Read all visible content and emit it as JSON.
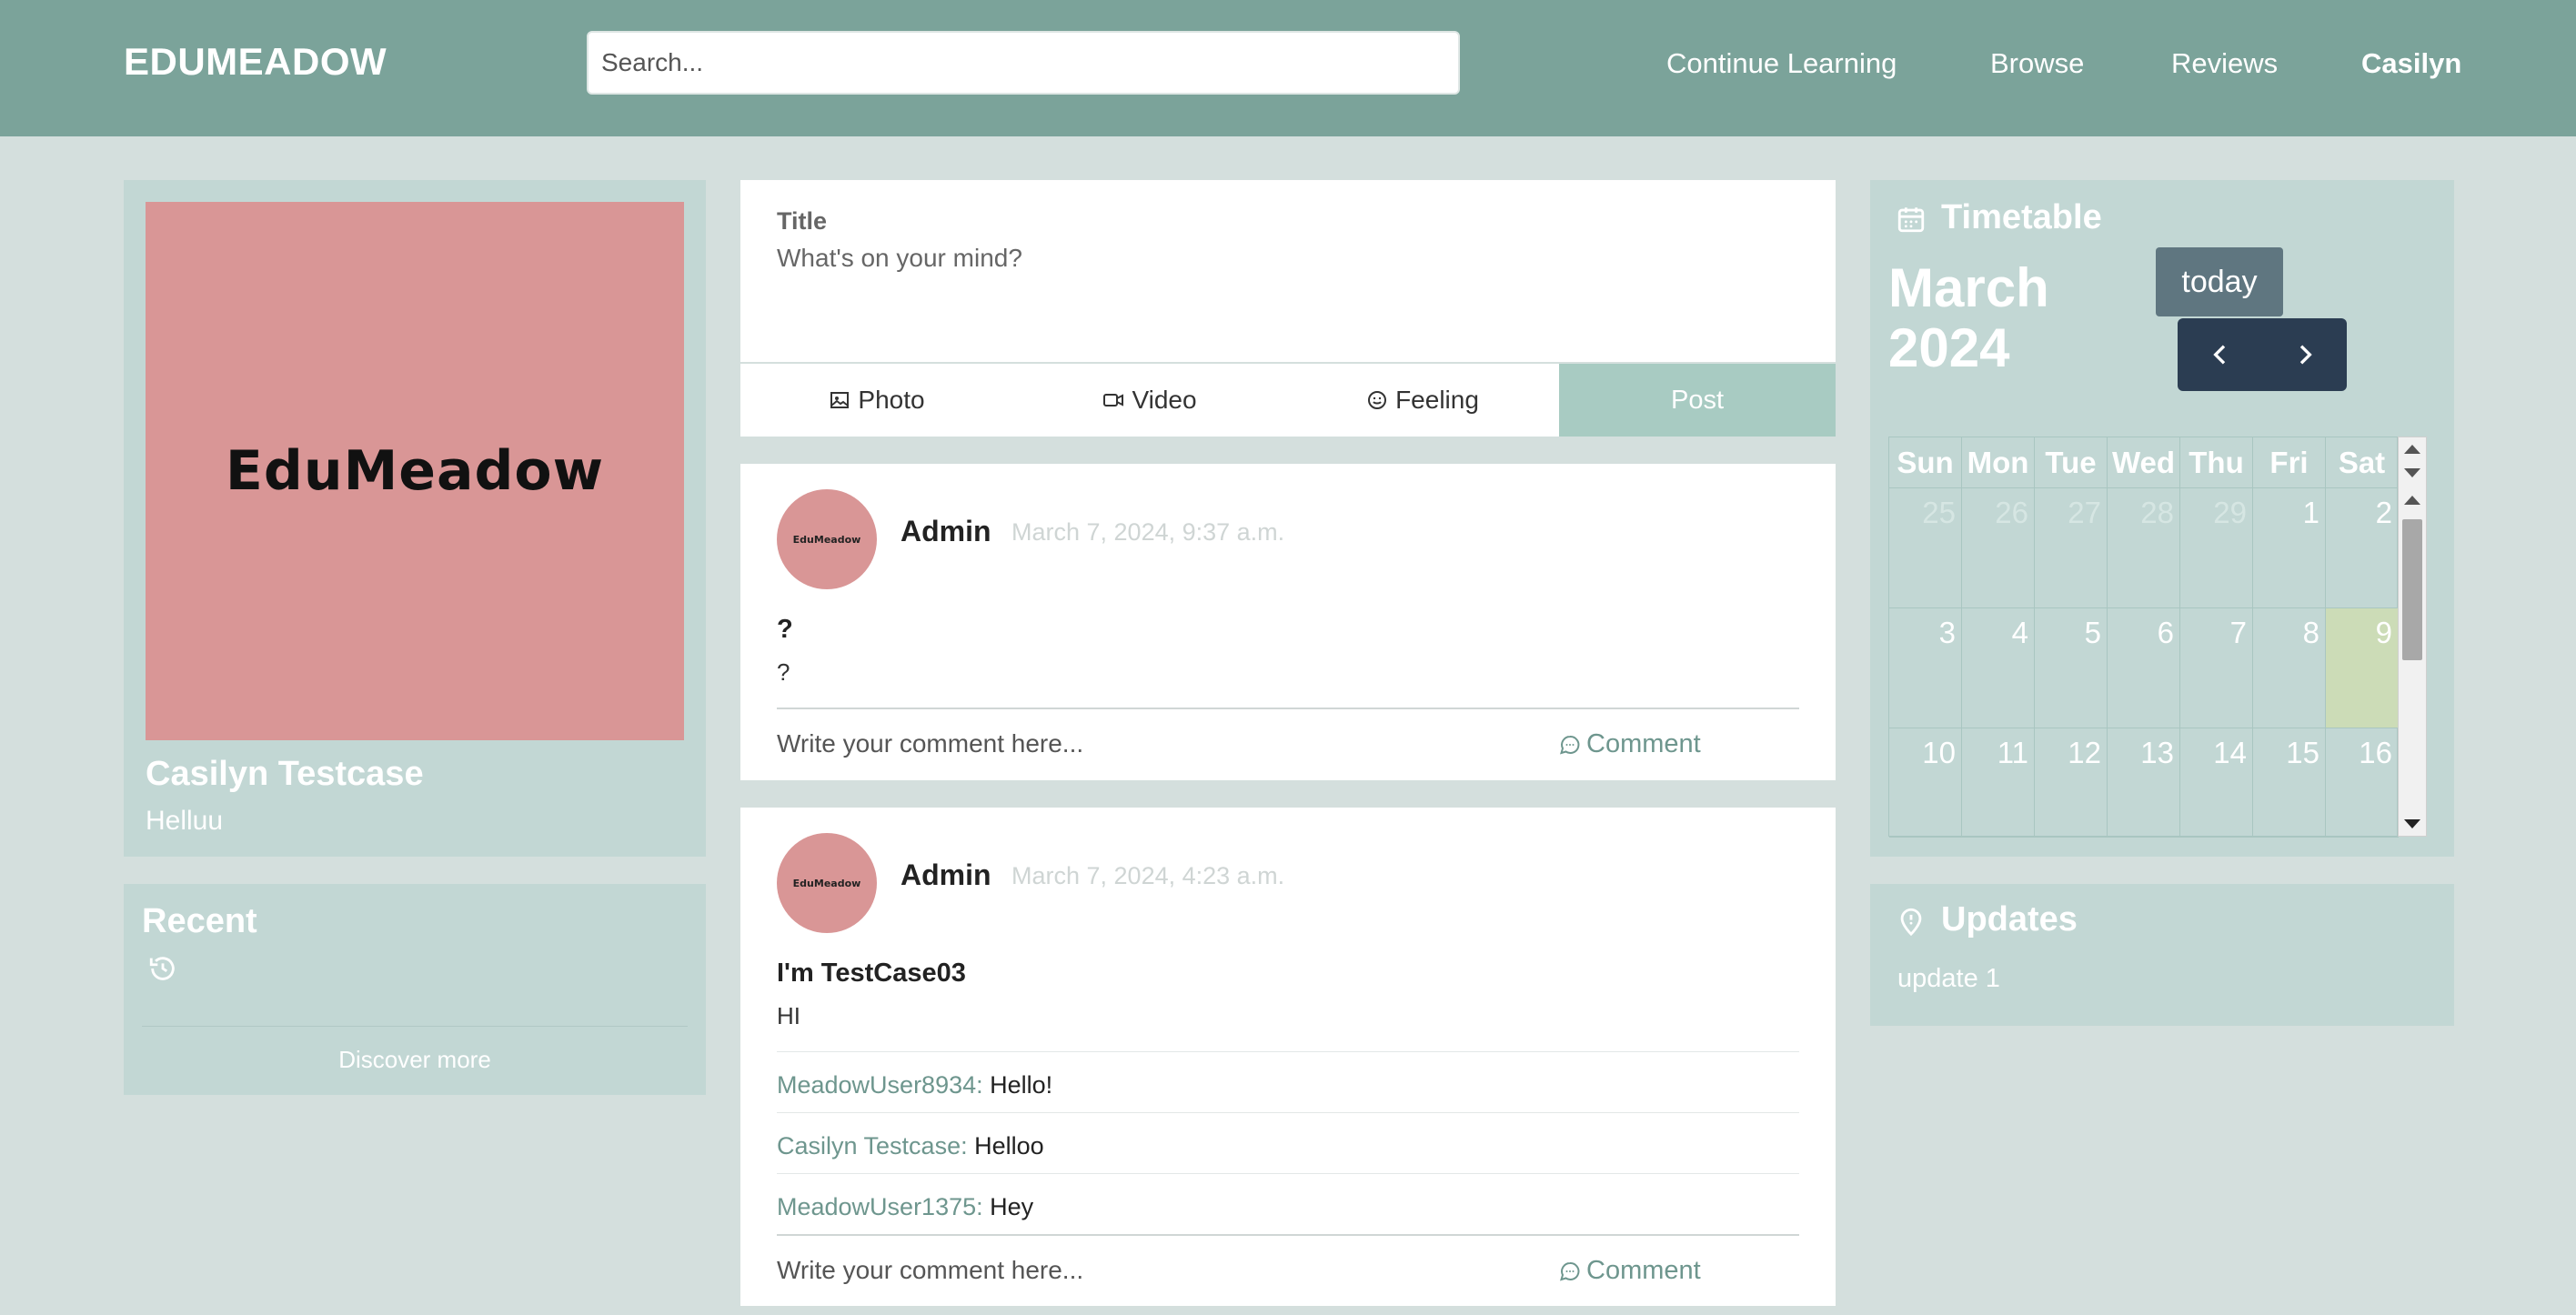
{
  "header": {
    "logo": "EDUMEADOW",
    "search_placeholder": "Search...",
    "nav": [
      "Continue Learning",
      "Browse",
      "Reviews",
      "Casilyn"
    ]
  },
  "profile": {
    "image_text": "EduMeadow",
    "name": "Casilyn Testcase",
    "bio": "Helluu"
  },
  "recent": {
    "title": "Recent",
    "icon": "history-icon",
    "discover_label": "Discover more"
  },
  "composer": {
    "title_label": "Title",
    "placeholder": "What's on your mind?",
    "actions": [
      "Photo",
      "Video",
      "Feeling"
    ],
    "post_label": "Post"
  },
  "posts": [
    {
      "avatar_text": "EduMeadow",
      "author": "Admin",
      "date": "March 7, 2024, 9:37 a.m.",
      "title": "?",
      "body": "?",
      "comments": [],
      "comment_placeholder": "Write your comment here...",
      "comment_label": "Comment"
    },
    {
      "avatar_text": "EduMeadow",
      "author": "Admin",
      "date": "March 7, 2024, 4:23 a.m.",
      "title": "I'm TestCase03",
      "body": "HI",
      "comments": [
        {
          "user": "MeadowUser8934:",
          "text": " Hello!"
        },
        {
          "user": "Casilyn Testcase:",
          "text": " Helloo"
        },
        {
          "user": "MeadowUser1375:",
          "text": " Hey"
        }
      ],
      "comment_placeholder": "Write your comment here...",
      "comment_label": "Comment"
    }
  ],
  "timetable": {
    "title": "Timetable",
    "month": "March 2024",
    "today_label": "today",
    "weekdays": [
      "Sun",
      "Mon",
      "Tue",
      "Wed",
      "Thu",
      "Fri",
      "Sat"
    ],
    "weeks": [
      [
        "25",
        "26",
        "27",
        "28",
        "29",
        "1",
        "2"
      ],
      [
        "3",
        "4",
        "5",
        "6",
        "7",
        "8",
        "9"
      ],
      [
        "10",
        "11",
        "12",
        "13",
        "14",
        "15",
        "16"
      ]
    ],
    "highlight_color": "#ccdcb7"
  },
  "updates": {
    "title": "Updates",
    "items": [
      "update 1"
    ]
  },
  "colors": {
    "header_bg": "#7ba39a",
    "panel_bg": "#c2d7d4",
    "page_bg": "#d4dfdd",
    "post_button": "#a8cbc2",
    "nav_dark": "#2b3d52"
  }
}
